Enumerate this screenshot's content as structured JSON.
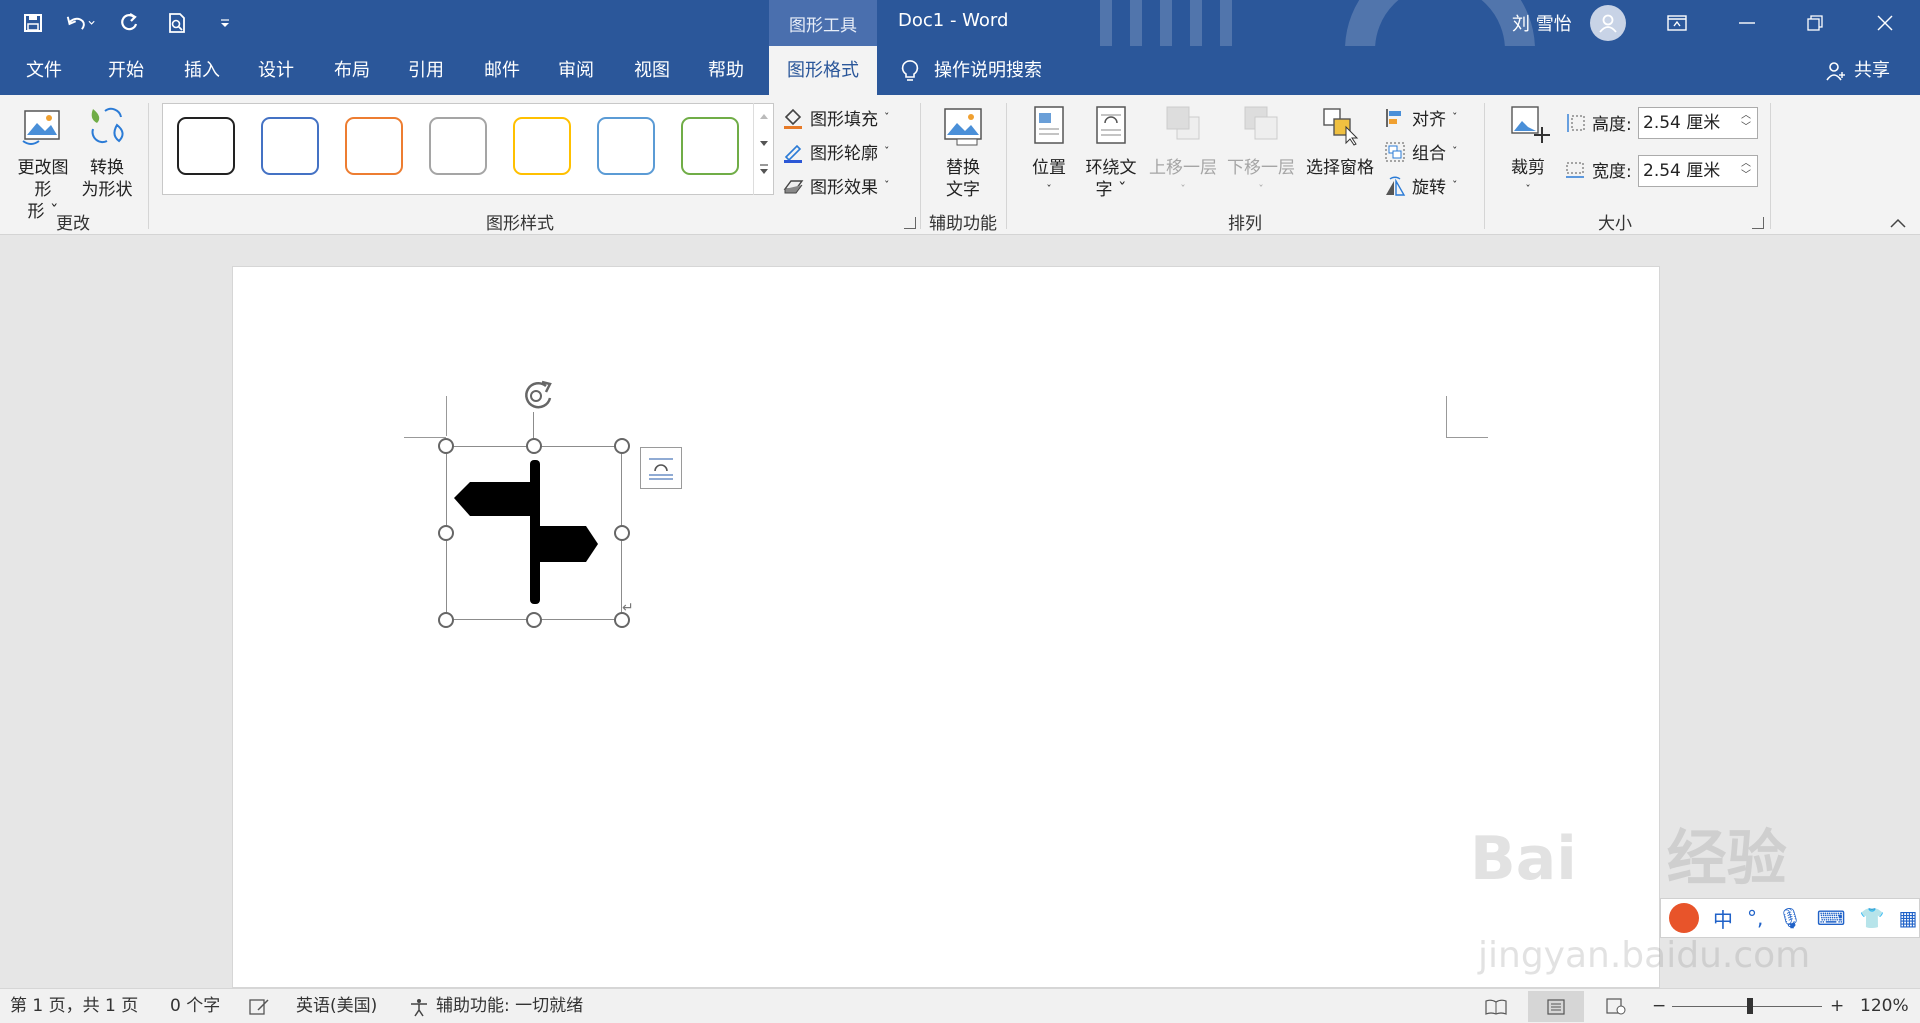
{
  "titlebar": {
    "context_tools": "图形工具",
    "doc_title": "Doc1  -  Word",
    "user_name": "刘 雪怡"
  },
  "tabs": [
    {
      "label": "文件"
    },
    {
      "label": "开始"
    },
    {
      "label": "插入"
    },
    {
      "label": "设计"
    },
    {
      "label": "布局"
    },
    {
      "label": "引用"
    },
    {
      "label": "邮件"
    },
    {
      "label": "审阅"
    },
    {
      "label": "视图"
    },
    {
      "label": "帮助"
    },
    {
      "label": "图形格式"
    }
  ],
  "tellme": "操作说明搜索",
  "share": "共享",
  "ribbon": {
    "change": {
      "change_shape": "更改图形",
      "change_shape2": "形 ˇ",
      "convert": "转换",
      "convert2": "为形状",
      "label": "更改"
    },
    "styles": {
      "swatch_colors": [
        "#222222",
        "#4472c4",
        "#ed7d31",
        "#a5a5a5",
        "#ffc000",
        "#5b9bd5",
        "#70ad47"
      ],
      "fill": "图形填充",
      "outline": "图形轮廓",
      "effects": "图形效果",
      "label": "图形样式"
    },
    "access": {
      "alt_text": "替换",
      "alt_text2": "文字",
      "label": "辅助功能"
    },
    "arrange": {
      "position": "位置",
      "wrap": "环绕文",
      "wrap2": "字 ˇ",
      "forward": "上移一层",
      "backward": "下移一层",
      "selection_pane": "选择窗格",
      "align": "对齐",
      "group": "组合",
      "rotate": "旋转",
      "label": "排列"
    },
    "size": {
      "crop": "裁剪",
      "height_label": "高度:",
      "height_value": "2.54 厘米",
      "width_label": "宽度:",
      "width_value": "2.54 厘米",
      "label": "大小"
    }
  },
  "status": {
    "page": "第 1 页，共 1 页",
    "words": "0 个字",
    "language": "英语(美国)",
    "accessibility": "辅助功能: 一切就绪",
    "zoom": "120%"
  },
  "ime": {
    "mode": "中"
  },
  "watermark": {
    "brand": "Bai",
    "brand2": "经验",
    "url": "jingyan.baidu.com"
  }
}
